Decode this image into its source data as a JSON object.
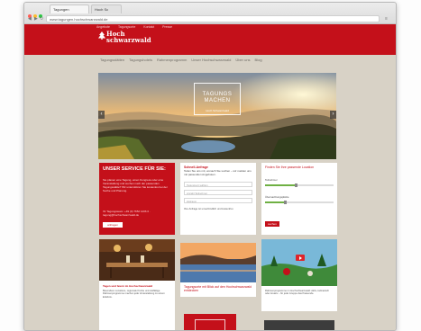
{
  "browser": {
    "tabs": [
      {
        "label": "Tagungen"
      },
      {
        "label": "Hoch Sc"
      }
    ],
    "address": "www.tagungen.hochschwarzwald.de",
    "colors": {
      "close": "#ff5f57",
      "minimize": "#febc2e",
      "zoom": "#28c840"
    }
  },
  "site": {
    "brand_color": "#c4101a",
    "toplinks": [
      "Angebote",
      "Tagungsorte",
      "Kontakt",
      "Presse"
    ],
    "logo": {
      "line1": "Hoch",
      "line2": "schwarzwald"
    },
    "nav": [
      "Tagungsstätten",
      "Tagungshotels",
      "Rahmenprogramm",
      "Unser Hochschwarzwald",
      "Über uns",
      "Blog"
    ]
  },
  "hero": {
    "title_line1": "TAGUNGS",
    "title_line2": "MACHEN",
    "subtitle": "Hoch Schwarzwald",
    "prev": "‹",
    "next": "›"
  },
  "service": {
    "title": "UNSER SERVICE FÜR SIE:",
    "text": "Sie planen eine Tagung, einen Kongress oder eine Veranstaltung und suchen nach der passenden Tagungsstätte? Wir unterstützen Sie kostenlos bei der Suche und Planung.",
    "link": "Ihr Tagungsteam: +49 (0) 7652 1206 0 · tagung@hochschwarzwald.de",
    "button": "anfragen"
  },
  "form": {
    "heading": "Schnell-Anfrage",
    "intro": "Teilen Sie uns mit, wonach Sie suchen – wir melden uns mit passenden Angeboten.",
    "fields": [
      "Tagungsort wählen",
      "Anzahl Teilnehmer",
      "Zeitraum"
    ],
    "note": "Ihre Anfrage ist unverbindlich und kostenfrei."
  },
  "finder": {
    "heading": "Finden Sie Ihre passende Location",
    "label1": "Teilnehmer",
    "label2": "Übernachtungsplätze",
    "value1": 0.45,
    "value2": 0.3,
    "button": "suchen"
  },
  "teasers": [
    {
      "title": "Tagen und feiern im Hochschwarzwald",
      "text": "Besondere Locations, regionale Küche und vielfältige Rahmenprogramme machen jede Veranstaltung zu einem Erlebnis."
    },
    {
      "link": "Tagungsorte mit Blick auf den Hochschwarzwald entdecken"
    },
    {
      "text": "Rahmenprogramme im Hochschwarzwald: Aktiv, kulinarisch oder kreativ – für jede Gruppe das Passende."
    }
  ]
}
